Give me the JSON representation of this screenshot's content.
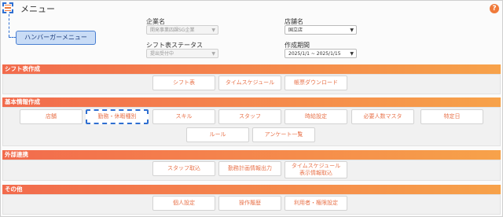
{
  "header": {
    "title": "メニュー",
    "help_label": "?",
    "callout_label": "ハンバーガーメニュー"
  },
  "filters": {
    "company_label": "企業名",
    "company_value": "開発事業四課SG企業",
    "shop_label": "店舗名",
    "shop_value": "国立店",
    "status_label": "シフト表ステータス",
    "status_value": "提出受付中",
    "period_label": "作成期間",
    "period_value": "2025/1/1 ~ 2025/1/15"
  },
  "sections": {
    "shift": {
      "title": "シフト表作成",
      "buttons": [
        "シフト表",
        "タイムスケジュール",
        "帳票ダウンロード"
      ]
    },
    "basic": {
      "title": "基本情報作成",
      "buttons": [
        "店舗",
        "勤務・休暇種別",
        "スキル",
        "スタッフ",
        "時給設定",
        "必要人数マスタ",
        "特定日",
        "ルール",
        "アンケート一覧"
      ]
    },
    "external": {
      "title": "外部連携",
      "buttons": [
        "スタッフ取込",
        "勤務計画情報出力"
      ],
      "timeschedule_line1": "タイムスケジュール",
      "timeschedule_line2": "表示情報取込"
    },
    "other": {
      "title": "その他",
      "buttons": [
        "個人設定",
        "操作履歴",
        "利用者・権限設定"
      ]
    }
  },
  "colors": {
    "accent": "#f07a3a",
    "bar_start": "#f26b4d",
    "bar_end": "#f7a24a",
    "button_text": "#e8734b",
    "highlight": "#2f6fd1"
  },
  "icons": {
    "menu": "hamburger-icon",
    "help": "help-icon",
    "dropdown": "caret-down-icon"
  }
}
